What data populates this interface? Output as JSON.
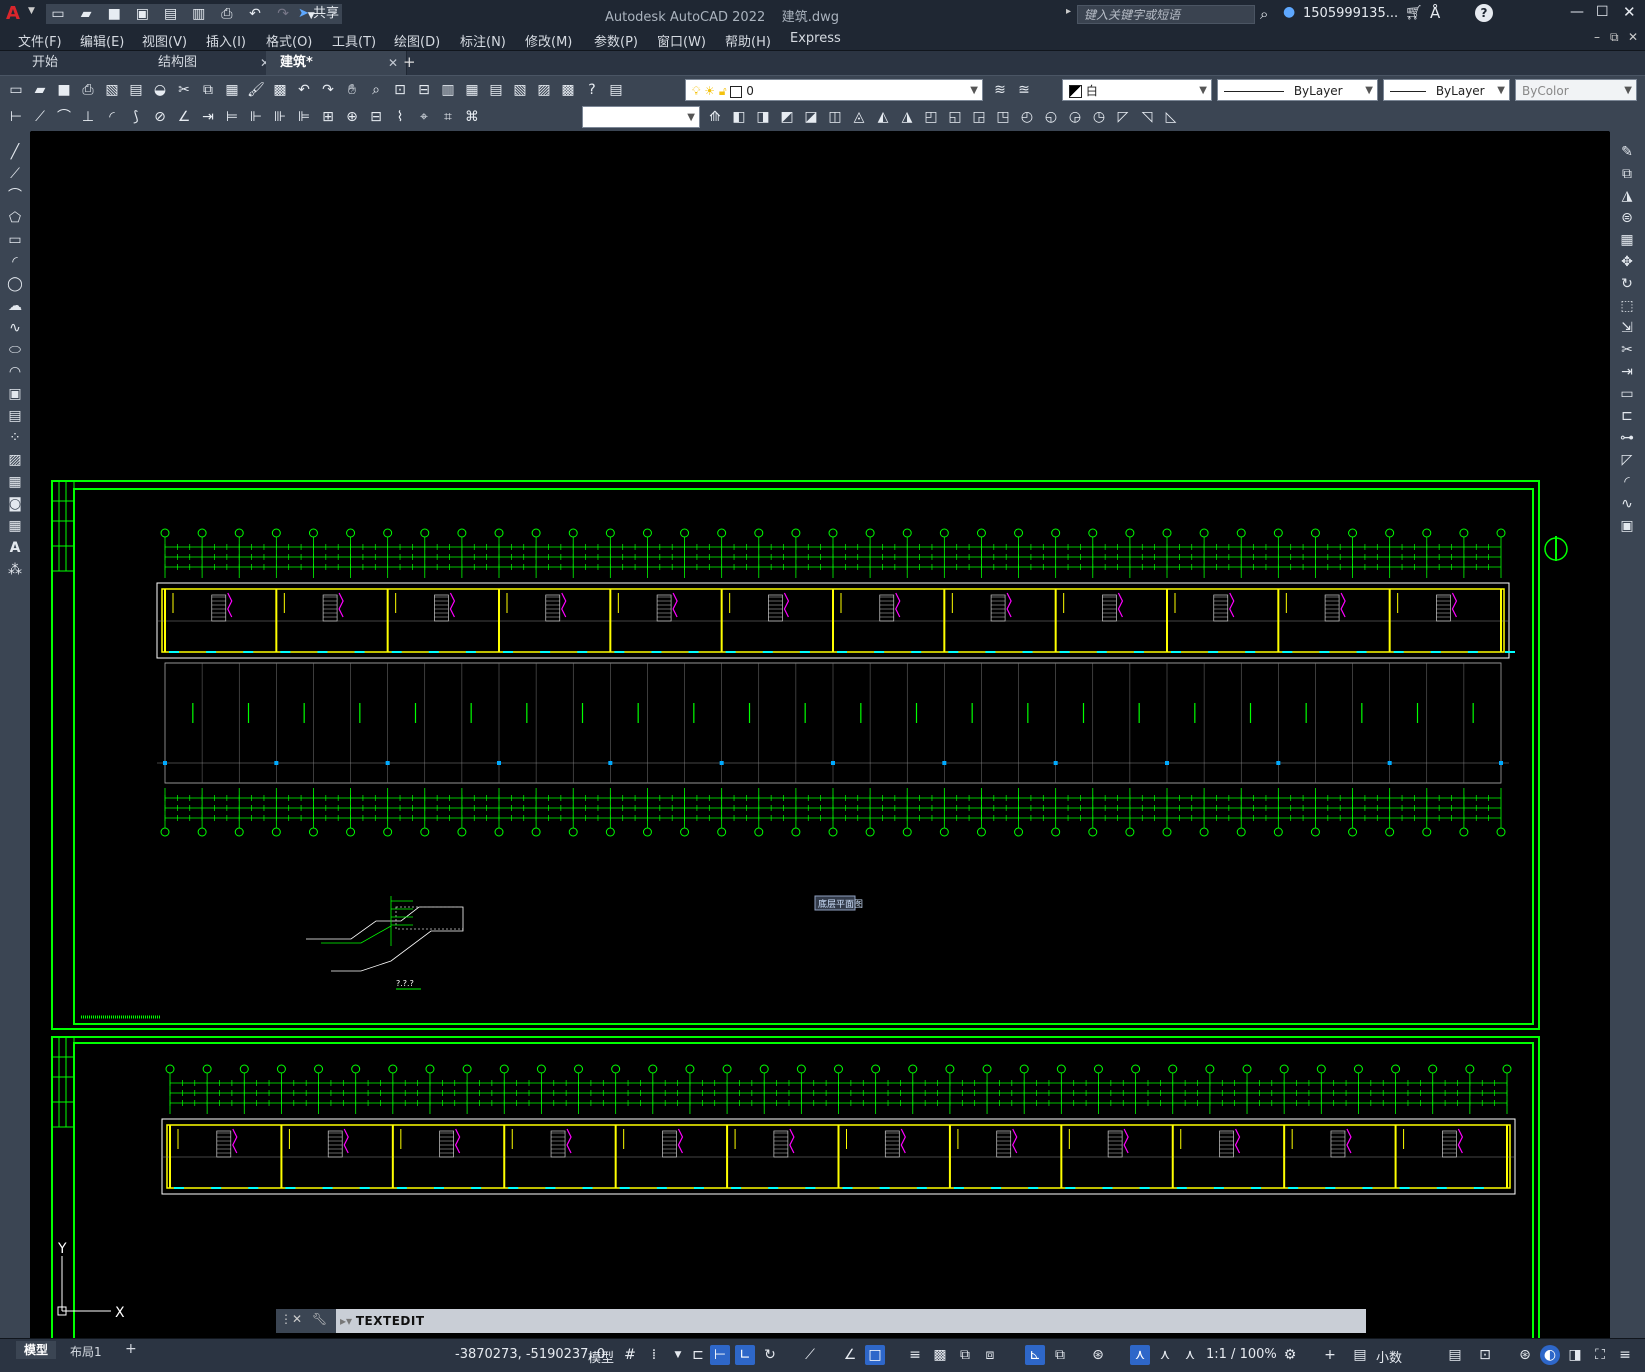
{
  "app": {
    "title": "Autodesk AutoCAD 2022",
    "filename": "建筑.dwg",
    "search_placeholder": "键入关键字或短语",
    "user": "1505999135...",
    "share_label": "共享"
  },
  "menu": [
    "文件(F)",
    "编辑(E)",
    "视图(V)",
    "插入(I)",
    "格式(O)",
    "工具(T)",
    "绘图(D)",
    "标注(N)",
    "修改(M)",
    "参数(P)",
    "窗口(W)",
    "帮助(H)",
    "Express"
  ],
  "doc_tabs": [
    {
      "label": "开始",
      "active": false,
      "closable": false
    },
    {
      "label": "结构图",
      "active": false,
      "closable": true
    },
    {
      "label": "建筑*",
      "active": true,
      "closable": true
    }
  ],
  "properties": {
    "layer": "0",
    "color": "白",
    "linetype": "ByLayer",
    "lineweight": "ByLayer",
    "plotstyle": "ByColor"
  },
  "command": {
    "text": "TEXTEDIT"
  },
  "status": {
    "coords": "-3870273, -5190237, 0",
    "model_label": "模型",
    "scale": "1:1 / 100%",
    "units": "小数"
  },
  "layout_tabs": [
    "模型",
    "布局1"
  ],
  "drawing": {
    "title_label": "底层平面图",
    "detail_label": "?.?.?",
    "ucs_x": "X",
    "ucs_y": "Y"
  },
  "colors": {
    "accent": "#2e67c9",
    "frame": "#00ff00",
    "wall": "#ffff00",
    "stair": "#ff00ff",
    "grid": "#ffffff"
  },
  "icons": {
    "app": "autocad-logo-icon",
    "search": "search-icon",
    "user": "user-icon",
    "cart": "cart-icon",
    "help": "help-icon"
  }
}
